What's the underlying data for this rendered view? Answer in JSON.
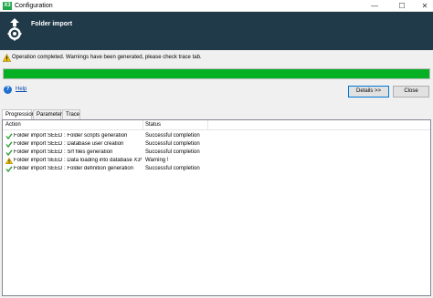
{
  "window": {
    "title": "Configuration",
    "logo": "X3",
    "controls": {
      "minimize": "—",
      "maximize": "☐",
      "close": "✕"
    }
  },
  "header": {
    "title": "Folder import",
    "icon": "upload-gear-icon",
    "background": "#203a4a"
  },
  "status": {
    "icon": "warning-icon",
    "message": "Operation completed. Warnings have been generated, please check trace tab."
  },
  "progress": {
    "value_percent": 100,
    "color": "#06b025"
  },
  "help": {
    "icon": "help-icon",
    "label": "Help"
  },
  "buttons": {
    "details": "Details >>",
    "close": "Close"
  },
  "tabs": [
    {
      "label": "Progression",
      "active": true
    },
    {
      "label": "Parameter",
      "active": false
    },
    {
      "label": "Trace",
      "active": false
    }
  ],
  "list": {
    "columns": {
      "action": "Action",
      "status": "Status"
    },
    "rows": [
      {
        "icon": "check-icon",
        "action": "Folder import SEED : Folder scripts generation",
        "status": "Successful completion"
      },
      {
        "icon": "check-icon",
        "action": "Folder import SEED : Database user creation",
        "status": "Successful completion"
      },
      {
        "icon": "check-icon",
        "action": "Folder import SEED : Srf files generation",
        "status": "Successful completion"
      },
      {
        "icon": "warning-icon",
        "action": "Folder import SEED : Data loading into database X3V12...",
        "status": "Warning !"
      },
      {
        "icon": "check-icon",
        "action": "Folder import SEED : Folder definition generation",
        "status": "Successful completion"
      }
    ]
  },
  "colors": {
    "check": "#2e9e3a",
    "warning_fill": "#f5c400",
    "accent": "#0078d7"
  }
}
